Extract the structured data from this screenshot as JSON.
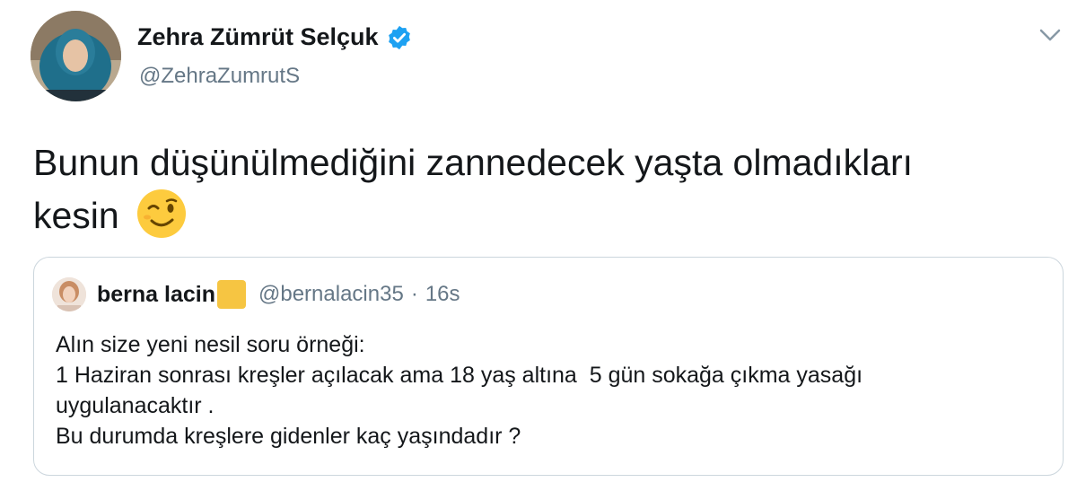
{
  "author": {
    "name": "Zehra Zümrüt Selçuk",
    "handle": "@ZehraZumrutS",
    "verified": true,
    "avatar_icon": "profile-photo"
  },
  "tweet": {
    "text_line1": "Bunun düşünülmediğini zannedecek yaşta olmadıkları",
    "text_line2": "kesin",
    "emoji": "winking-face"
  },
  "quoted_tweet": {
    "author_name": "berna lacin",
    "author_handle": "@bernalacin35",
    "separator": "·",
    "time": "16s",
    "lines": [
      "Alın size yeni nesil soru örneği:",
      "1 Haziran sonrası kreşler açılacak ama 18 yaş altına  5 gün sokağa çıkma yasağı",
      "uygulanacaktır .",
      "Bu durumda kreşlere gidenler kaç yaşındadır ?"
    ]
  },
  "colors": {
    "text": "#14171a",
    "secondary": "#657786",
    "verified_blue": "#1da1f2",
    "border": "#ccd6dd"
  }
}
